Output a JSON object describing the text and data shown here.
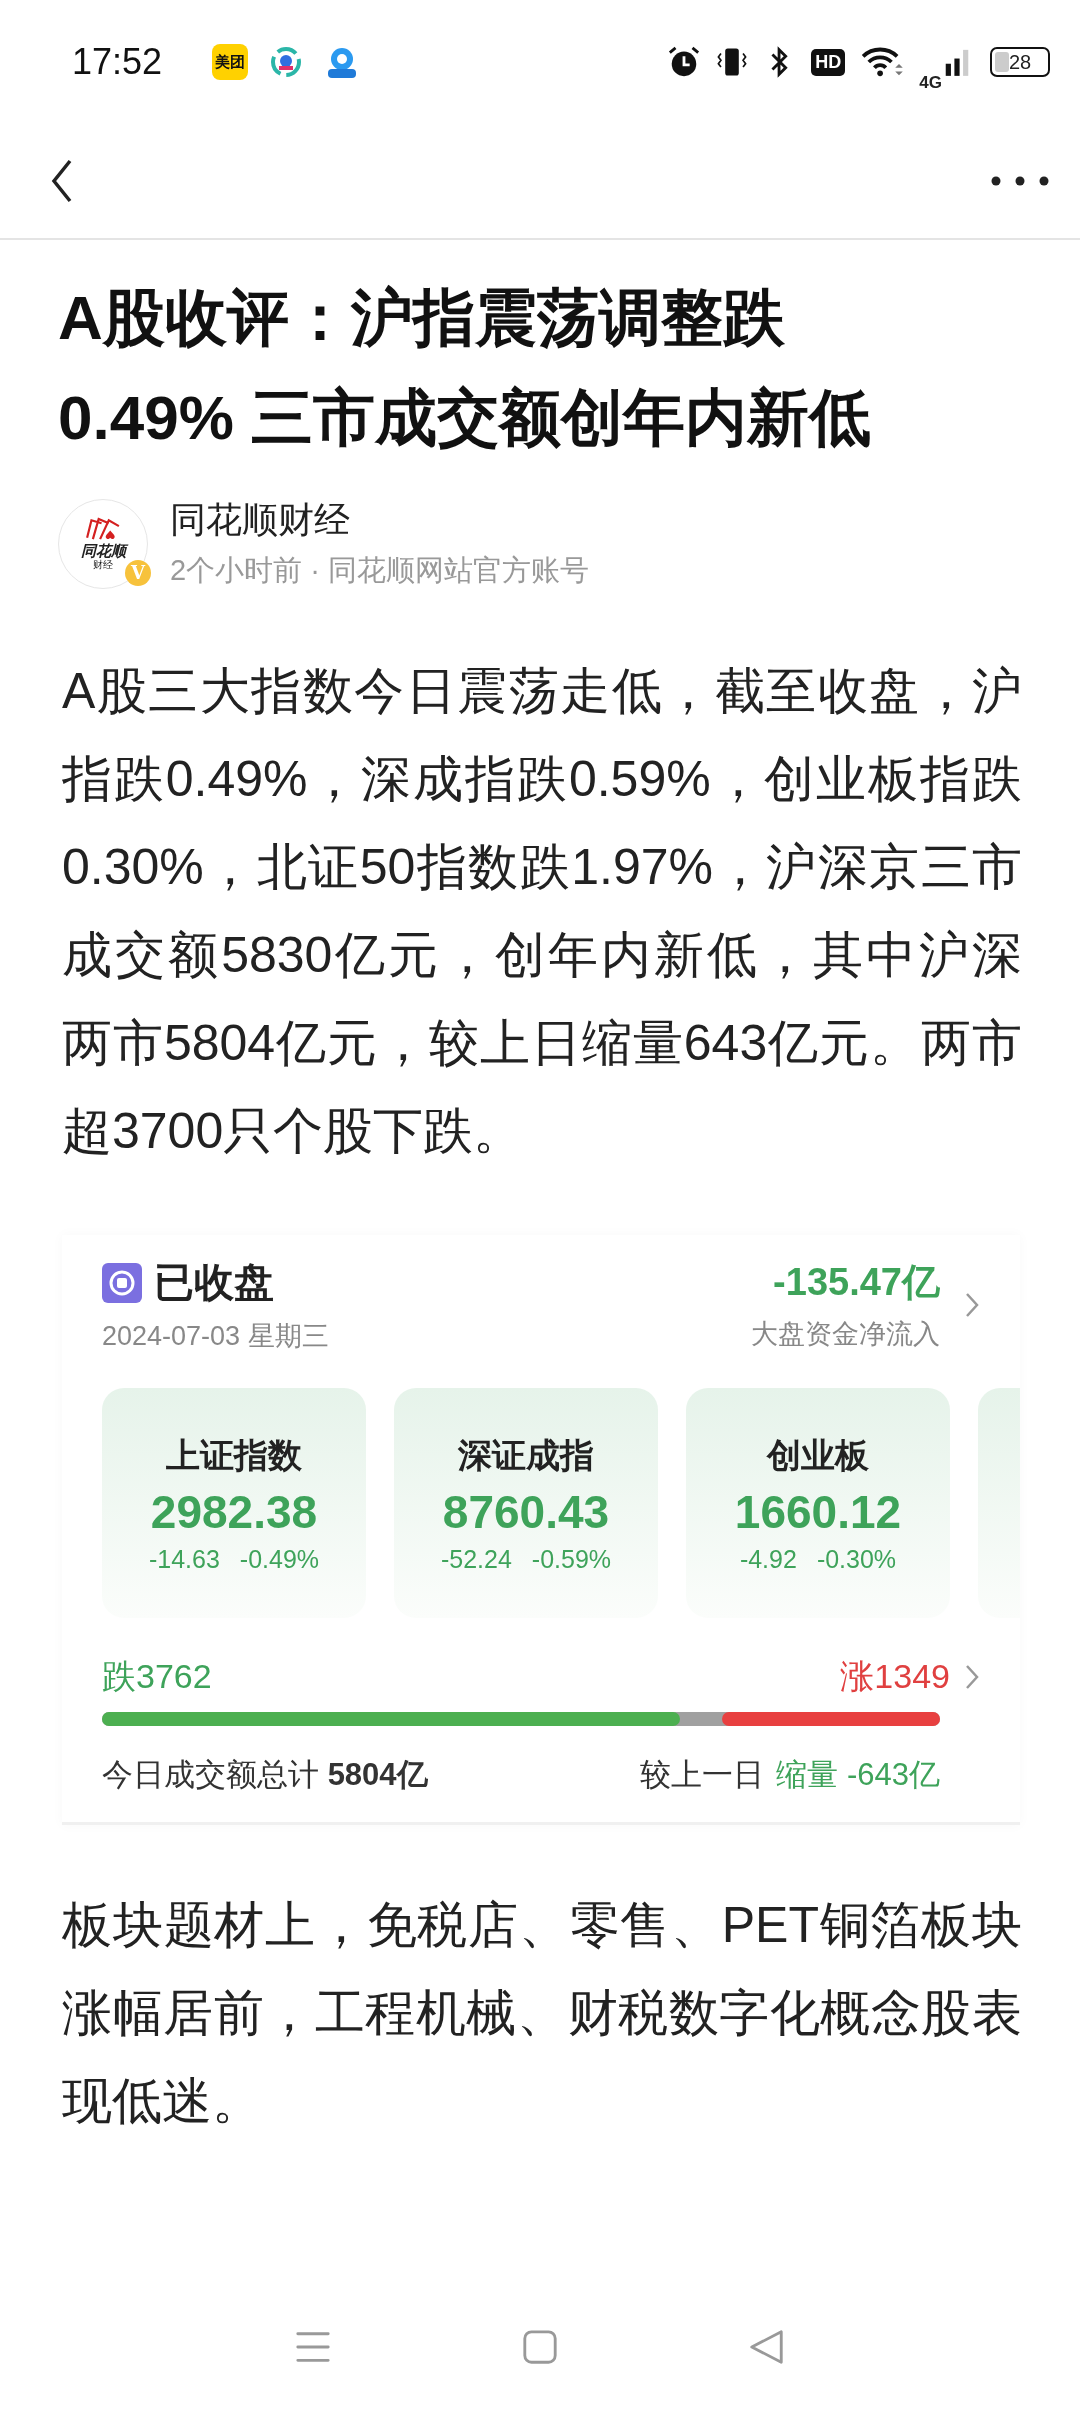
{
  "status_bar": {
    "time": "17:52",
    "app_icons": [
      {
        "kind": "meituan",
        "label": "美团"
      },
      {
        "kind": "ring"
      },
      {
        "kind": "map"
      }
    ],
    "hd_label": "HD",
    "network": "4G",
    "battery": "28"
  },
  "article": {
    "title": "A股收评：沪指震荡调整跌0.49% 三市成交额创年内新低",
    "author": {
      "name": "同花顺财经",
      "meta": "2个小时前 · 同花顺网站官方账号",
      "logo_text": "同花顺",
      "logo_subtext": "财经",
      "badge": "V"
    },
    "body": [
      {
        "kind": "paragraph",
        "text": "A股三大指数今日震荡走低，截至收盘，沪指跌0.49%，深成指跌0.59%，创业板指跌0.30%，北证50指数跌1.97%，沪深京三市成交额5830亿元，创年内新低，其中沪深两市5804亿元，较上日缩量643亿元。两市超3700只个股下跌。"
      },
      {
        "kind": "market_card",
        "status": "已收盘",
        "date": "2024-07-03 星期三",
        "net_flow": "-135.47亿",
        "net_flow_label": "大盘资金净流入",
        "indices": [
          {
            "name": "上证指数",
            "value": "2982.38",
            "change": "-14.63",
            "percent": "-0.49%"
          },
          {
            "name": "深证成指",
            "value": "8760.43",
            "change": "-52.24",
            "percent": "-0.59%"
          },
          {
            "name": "创业板",
            "value": "1660.12",
            "change": "-4.92",
            "percent": "-0.30%"
          }
        ],
        "fall": "跌3762",
        "rise": "涨1349",
        "breadth": [
          {
            "kind": "fall",
            "level": 0.69
          },
          {
            "kind": "rise",
            "level": 0.26
          }
        ],
        "turnover": "今日成交额总计 **5804亿**",
        "compare_label": "较上一日",
        "compare_value": "缩量 -643亿"
      },
      {
        "kind": "paragraph",
        "text": "板块题材上，免税店、零售、PET铜箔板块涨幅居前，工程机械、财税数字化概念股表现低迷。"
      }
    ]
  }
}
